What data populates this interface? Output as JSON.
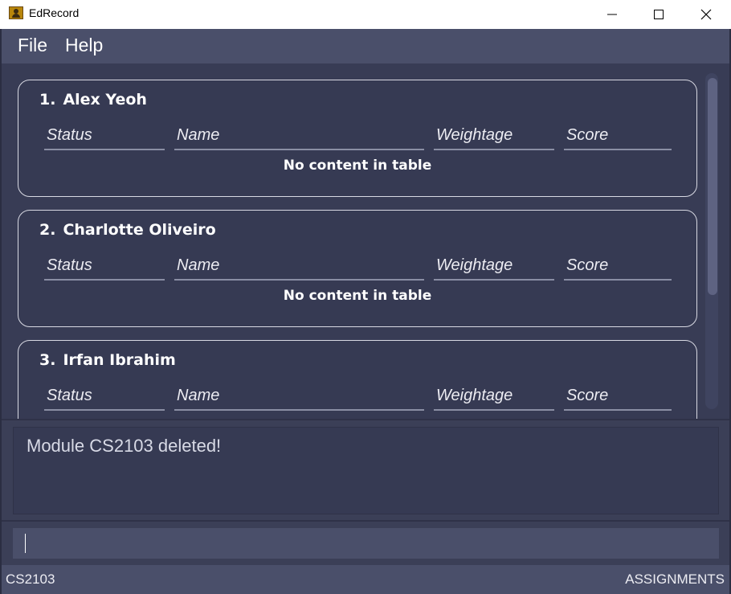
{
  "window": {
    "title": "EdRecord"
  },
  "menu": {
    "file": "File",
    "help": "Help"
  },
  "columns": {
    "status": "Status",
    "name": "Name",
    "weightage": "Weightage",
    "score": "Score"
  },
  "students": [
    {
      "index": "1.",
      "name": "Alex Yeoh",
      "empty_message": "No content in table"
    },
    {
      "index": "2.",
      "name": "Charlotte Oliveiro",
      "empty_message": "No content in table"
    },
    {
      "index": "3.",
      "name": "Irfan Ibrahim"
    }
  ],
  "result": {
    "message": "Module CS2103 deleted!"
  },
  "command": {
    "value": ""
  },
  "status_bar": {
    "module": "CS2103",
    "view": "ASSIGNMENTS"
  },
  "colors": {
    "background": "#3b3f57",
    "menubar": "#4a4f6a",
    "card_border": "#d8d9e3"
  },
  "icons": {
    "app": "edrecord-app-icon",
    "minimize": "minimize-icon",
    "maximize": "maximize-icon",
    "close": "close-icon"
  }
}
